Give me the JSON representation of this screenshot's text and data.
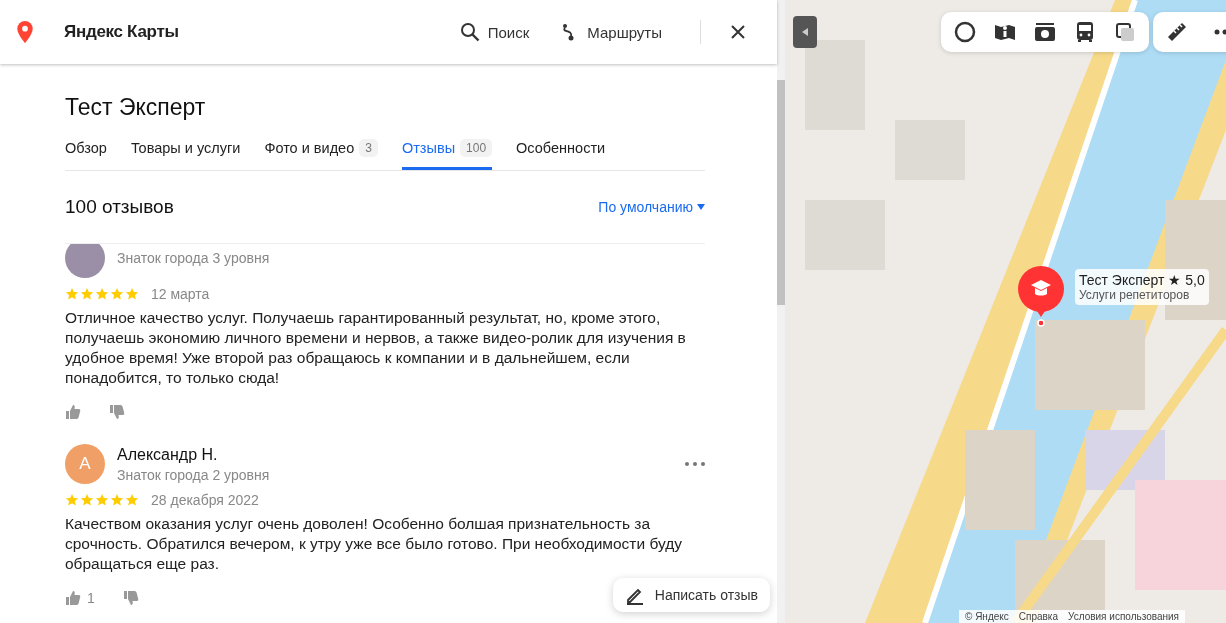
{
  "header": {
    "logo": "Яндекс Карты",
    "search": "Поиск",
    "routes": "Маршруты"
  },
  "org": {
    "title": "Тест Эксперт",
    "tabs": [
      {
        "label": "Обзор",
        "selected": false
      },
      {
        "label": "Товары и услуги",
        "selected": false
      },
      {
        "label": "Фото и видео",
        "count": "3",
        "selected": false
      },
      {
        "label": "Отзывы",
        "count": "100",
        "selected": true
      },
      {
        "label": "Особенности",
        "selected": false
      }
    ]
  },
  "reviews_header": {
    "count": "100 отзывов",
    "sort": "По умолчанию"
  },
  "reviews": [
    {
      "level": "Знаток города 3 уровня",
      "stars": 5,
      "date": "12 марта",
      "text": "Отличное качество услуг. Получаешь гарантированный результат, но, кроме этого, получаешь экономию личного времени и нервов, а также видео-ролик для изучения в удобное время! Уже второй раз обращаюсь к компании и в дальнейшем, если понадобится, то только сюда!"
    },
    {
      "avatar": "А",
      "color": "#f0a066",
      "name": "Александр Н.",
      "level": "Знаток города 2 уровня",
      "stars": 5,
      "date": "28 декабря 2022",
      "text": "Качеством оказания услуг очень доволен! Особенно болшая признательность за срочность. Обратился вечером, к утру уже все было готово. При необходимости буду обращаться еще раз.",
      "likes": "1"
    }
  ],
  "write_review": "Написать отзыв",
  "map": {
    "place": {
      "name": "Тест Эксперт",
      "rating": "★ 5,0",
      "category": "Услуги репетиторов"
    },
    "footer": [
      "© Яндекс",
      "Справка",
      "Условия использования"
    ]
  }
}
